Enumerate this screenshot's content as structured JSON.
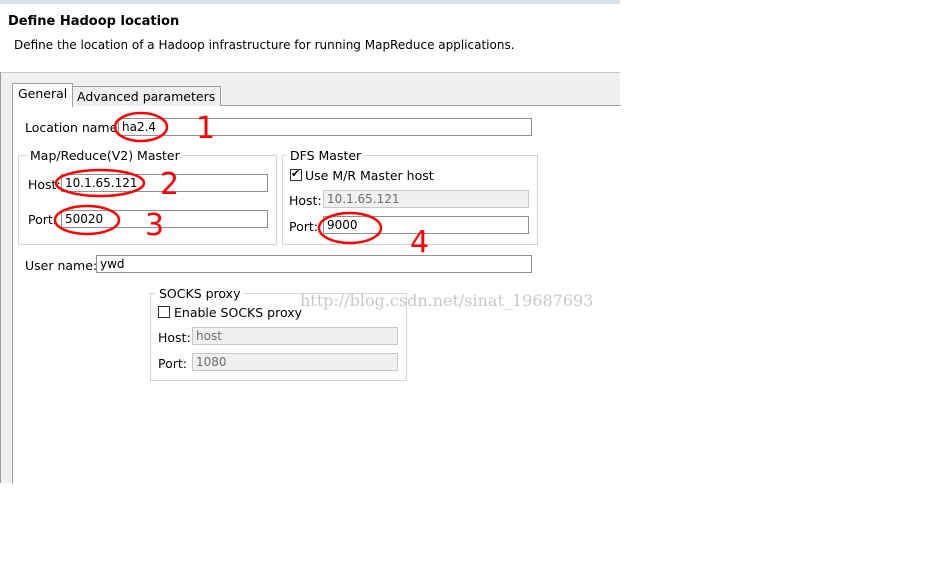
{
  "dialog": {
    "title": "Define Hadoop location",
    "subtitle": "Define the location of a Hadoop infrastructure for running MapReduce applications."
  },
  "tabs": [
    {
      "label": "General",
      "active": true
    },
    {
      "label": "Advanced parameters",
      "active": false
    }
  ],
  "location": {
    "label": "Location name:",
    "value": "ha2.4"
  },
  "mr_master": {
    "title": "Map/Reduce(V2) Master",
    "host_label": "Host:",
    "host_value": "10.1.65.121",
    "port_label": "Port:",
    "port_value": "50020"
  },
  "dfs_master": {
    "title": "DFS Master",
    "use_mr_label": "Use M/R Master host",
    "use_mr_checked": true,
    "host_label": "Host:",
    "host_value": "10.1.65.121",
    "port_label": "Port:",
    "port_value": "9000"
  },
  "user": {
    "label": "User name:",
    "value": "ywd"
  },
  "socks": {
    "title": "SOCKS proxy",
    "enable_label": "Enable SOCKS proxy",
    "enable_checked": false,
    "host_label": "Host:",
    "host_value": "host",
    "port_label": "Port:",
    "port_value": "1080"
  },
  "watermark": "http://blog.csdn.net/sinat_19687693",
  "annotations": {
    "color": "#ff0000",
    "numbers": [
      "1",
      "2",
      "3",
      "4"
    ]
  }
}
